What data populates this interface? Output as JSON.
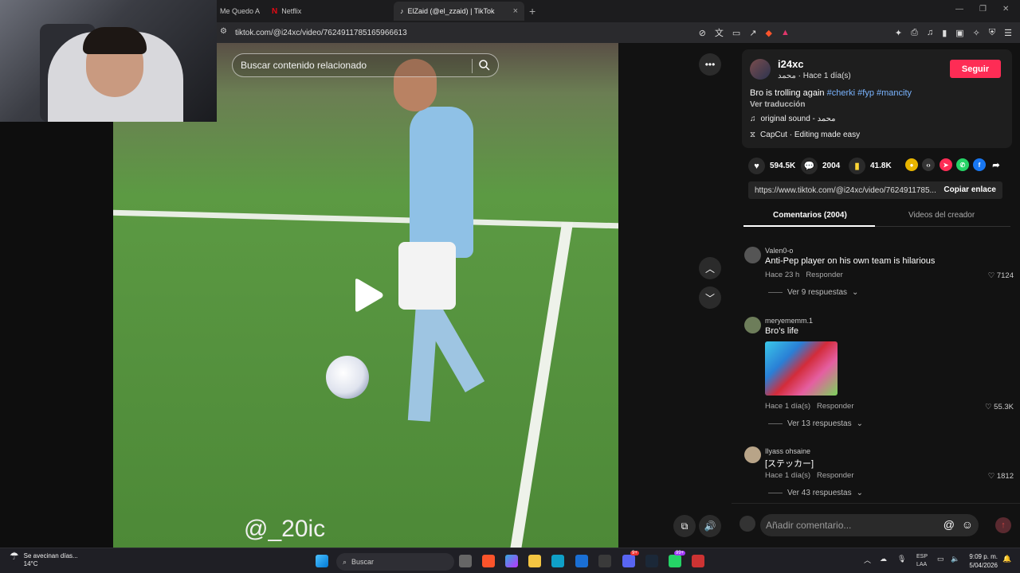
{
  "browser": {
    "tabs": [
      {
        "label": "Me Quedo A"
      },
      {
        "label": "Netflix"
      },
      {
        "label": "ElZaid (@el_zzaid) | TikTok"
      }
    ],
    "tab_close": "×",
    "new_tab": "+",
    "url": "tiktok.com/@i24xc/video/7624911785165966613"
  },
  "video": {
    "search_placeholder": "Buscar contenido relacionado",
    "watermark": "@_20ic"
  },
  "post": {
    "username": "i24xc",
    "subline": "محمد · Hace 1 día(s)",
    "follow_label": "Seguir",
    "caption_text": "Bro is trolling again ",
    "hashtags": [
      "#cherki",
      "#fyp",
      "#mancity"
    ],
    "translate": "Ver traducción",
    "sound": "original sound - محمد",
    "capcut": "CapCut · Editing made easy",
    "likes": "594.5K",
    "comments_count": "2004",
    "saves": "41.8K",
    "link": "https://www.tiktok.com/@i24xc/video/7624911785...",
    "copy_label": "Copiar enlace"
  },
  "side_tabs": {
    "comments": "Comentarios (2004)",
    "creator": "Videos del creador"
  },
  "comments": [
    {
      "user": "Valen0-o",
      "text": "Anti-Pep player on his own team is hilarious",
      "time": "Hace 23 h",
      "reply": "Responder",
      "likes": "7124",
      "replies": "Ver 9 respuestas"
    },
    {
      "user": "meryememm.1",
      "text": "Bro’s life",
      "time": "Hace 1 día(s)",
      "reply": "Responder",
      "likes": "55.3K",
      "replies": "Ver 13 respuestas"
    },
    {
      "user": "Ilyass ohsaine",
      "text": "[ステッカー]",
      "time": "Hace 1 día(s)",
      "reply": "Responder",
      "likes": "1812",
      "replies": "Ver 43 respuestas"
    }
  ],
  "comment_input": {
    "placeholder": "Añadir comentario..."
  },
  "taskbar": {
    "weather_text": "Se avecinan días...",
    "temp": "14°C",
    "search": "Buscar",
    "lang1": "ESP",
    "lang2": "LAA",
    "time": "9:09 p. m.",
    "date": "5/04/2026",
    "badge1": "9+",
    "badge2": "99+"
  },
  "colors": {
    "accent": "#fe2c55",
    "hashtag": "#7ab4ff"
  }
}
